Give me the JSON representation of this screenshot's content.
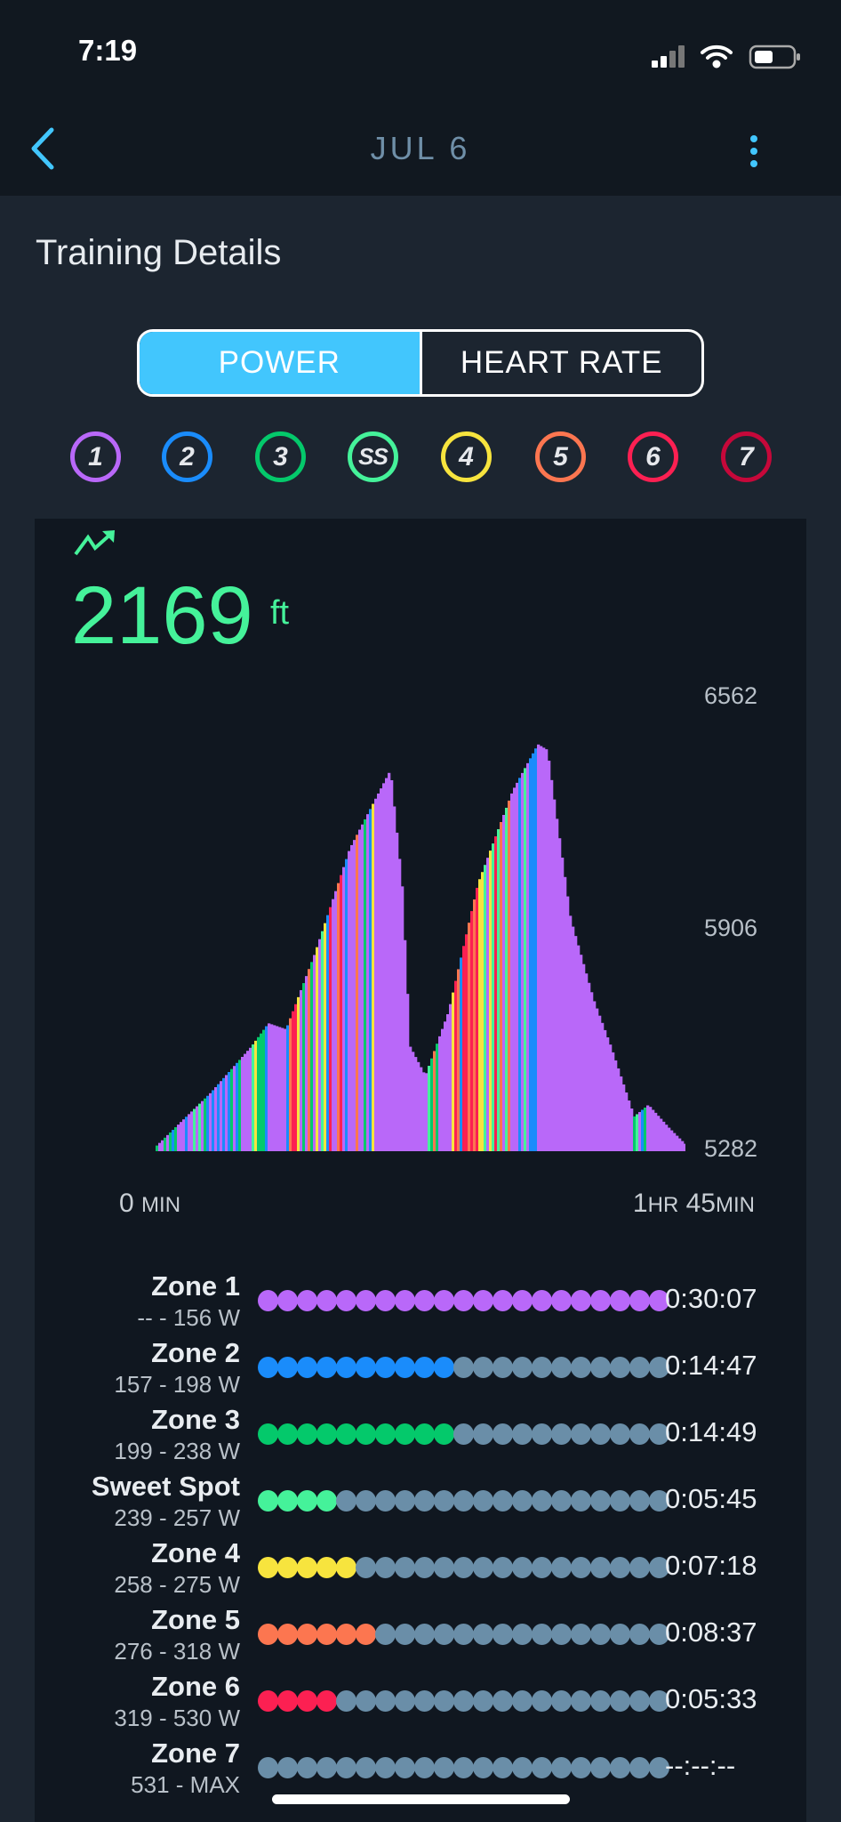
{
  "status": {
    "time": "7:19"
  },
  "nav": {
    "title": "JUL 6"
  },
  "page": {
    "title": "Training Details"
  },
  "toggle": {
    "options": [
      "POWER",
      "HEART RATE"
    ],
    "selected": "POWER",
    "accent": "#42c6fd"
  },
  "zone_filters": [
    {
      "label": "1",
      "color": "#b968f9"
    },
    {
      "label": "2",
      "color": "#1a8cfb"
    },
    {
      "label": "3",
      "color": "#04c96b"
    },
    {
      "label": "SS",
      "color": "#45f29a"
    },
    {
      "label": "4",
      "color": "#f7e43e"
    },
    {
      "label": "5",
      "color": "#fc7650"
    },
    {
      "label": "6",
      "color": "#fc2052"
    },
    {
      "label": "7",
      "color": "#c6083a"
    }
  ],
  "metric": {
    "value": "2169",
    "unit": "ft",
    "icon": "trending-up-icon",
    "color": "#45f29a"
  },
  "chart_data": {
    "type": "area",
    "x_unit": "min",
    "xlim": [
      0,
      105
    ],
    "ylim": [
      5282,
      6562
    ],
    "y_ticks": [
      "6562",
      "5906",
      "5282"
    ],
    "x_start_label": {
      "num": "0",
      "unit": "MIN"
    },
    "x_end_label": {
      "num1": "1",
      "unit1": "HR",
      "num2": "45",
      "unit2": "MIN"
    },
    "x": [
      0,
      10.6,
      18.7,
      22.1,
      25.6,
      31.3,
      38.2,
      46.3,
      48.6,
      50.2,
      53.2,
      57.8,
      63.6,
      70.5,
      75.5,
      77.4,
      82,
      86.6,
      90,
      94.6,
      97.4,
      101.5,
      105
    ],
    "y": [
      5298,
      5446,
      5577,
      5643,
      5626,
      5840,
      6135,
      6358,
      6036,
      5577,
      5495,
      5676,
      6036,
      6299,
      6430,
      6414,
      5938,
      5708,
      5577,
      5380,
      5413,
      5348,
      5298
    ],
    "fill_note": "colored by power zone"
  },
  "zones": [
    {
      "name": "Zone 1",
      "range": "-- - 156 W",
      "time": "0:30:07",
      "filled": 21,
      "color": "#b968f9"
    },
    {
      "name": "Zone 2",
      "range": "157 - 198 W",
      "time": "0:14:47",
      "filled": 10,
      "color": "#1a8cfb"
    },
    {
      "name": "Zone 3",
      "range": "199 - 238 W",
      "time": "0:14:49",
      "filled": 10,
      "color": "#04c96b"
    },
    {
      "name": "Sweet Spot",
      "range": "239 - 257 W",
      "time": "0:05:45",
      "filled": 4,
      "color": "#45f29a"
    },
    {
      "name": "Zone 4",
      "range": "258 - 275 W",
      "time": "0:07:18",
      "filled": 5,
      "color": "#f7e43e"
    },
    {
      "name": "Zone 5",
      "range": "276 - 318 W",
      "time": "0:08:37",
      "filled": 6,
      "color": "#fc7650"
    },
    {
      "name": "Zone 6",
      "range": "319 - 530 W",
      "time": "0:05:33",
      "filled": 4,
      "color": "#fc2052"
    },
    {
      "name": "Zone 7",
      "range": "531 - MAX",
      "time": "--:--:--",
      "filled": 0,
      "color": "#c6083a"
    }
  ],
  "zone_dots_total": 21,
  "empty_dot_color": "#6a8ea8"
}
